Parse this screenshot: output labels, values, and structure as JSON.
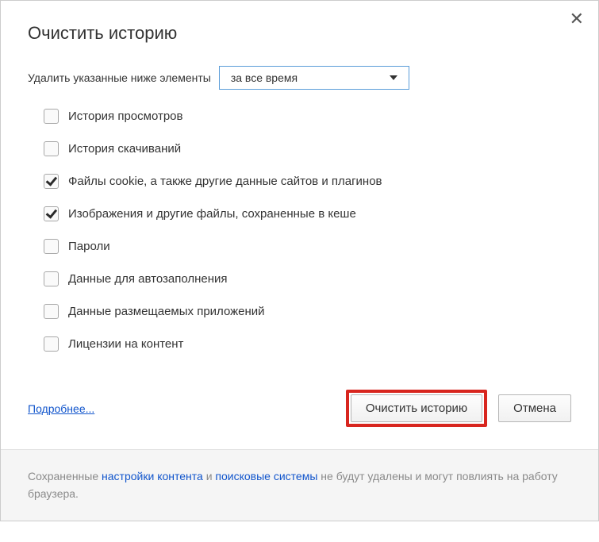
{
  "dialog": {
    "title": "Очистить историю",
    "rangeLabel": "Удалить указанные ниже элементы",
    "rangeSelected": "за все время",
    "options": [
      {
        "label": "История просмотров",
        "checked": false
      },
      {
        "label": "История скачиваний",
        "checked": false
      },
      {
        "label": "Файлы cookie, а также другие данные сайтов и плагинов",
        "checked": true
      },
      {
        "label": "Изображения и другие файлы, сохраненные в кеше",
        "checked": true
      },
      {
        "label": "Пароли",
        "checked": false
      },
      {
        "label": "Данные для автозаполнения",
        "checked": false
      },
      {
        "label": "Данные размещаемых приложений",
        "checked": false
      },
      {
        "label": "Лицензии на контент",
        "checked": false
      }
    ],
    "learnMore": "Подробнее...",
    "clearButton": "Очистить историю",
    "cancelButton": "Отмена"
  },
  "footer": {
    "prefix": "Сохраненные ",
    "link1": "настройки контента",
    "mid": " и ",
    "link2": "поисковые системы",
    "suffix": " не будут удалены и могут повлиять на работу браузера."
  }
}
